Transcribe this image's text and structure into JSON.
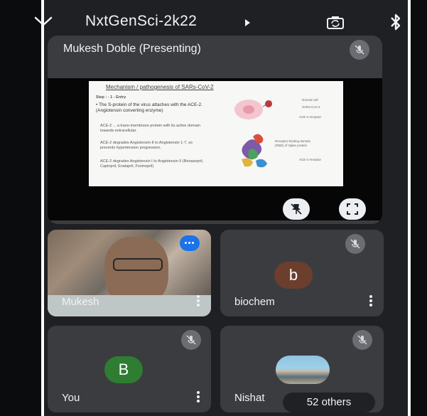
{
  "header": {
    "meeting_title": "NxtGenSci-2k22"
  },
  "presentation": {
    "presenter_label": "Mukesh Doble (Presenting)",
    "slide": {
      "title": "Mechanism / pathogenesis of SARs-CoV-2",
      "step": "Step : - 1 - Entry",
      "bullet_1": "• The S-protein of the virus attaches with the ACE-2. (Angiotensin converting enzyme)",
      "bullet_2": "ACE-2 ... a trans-membrane protein with its active domain towards extracellular.",
      "bullet_3": "ACE-2 degrades Angiotensin-II to Angiotensin 1-7, so prevents hypertension progression.",
      "bullet_4": "ACE-2 degrades Angiotensin I to Angiotensin II (Benazepril, Captopril, Enalapril, Fosinopril)",
      "label_host": "Normal cell",
      "label_virus": "SARs-CoV-2",
      "label_receptor": "ACE-2 receptor",
      "label_rbd": "Receptor binding domain (RBD) of Spike protein",
      "label_ace2": "ACE-2 receptor"
    }
  },
  "participants": [
    {
      "name": "Mukesh",
      "type": "video"
    },
    {
      "name": "biochem",
      "avatar_letter": "b",
      "avatar_color": "#6b3e2e"
    },
    {
      "name": "You",
      "avatar_letter": "B",
      "avatar_color": "#2e7d32"
    },
    {
      "name": "Nishat",
      "type": "photo"
    }
  ],
  "others_label": "52 others",
  "icons": {
    "collapse": "chevron-down-icon",
    "title_dropdown": "caret-right-icon",
    "camera": "camera-flip-icon",
    "audio": "bluetooth-icon",
    "muted": "mic-off-icon",
    "pin": "pin-off-icon",
    "fullscreen": "fullscreen-icon",
    "more": "more-vertical-icon",
    "reactions": "more-horizontal-icon"
  }
}
